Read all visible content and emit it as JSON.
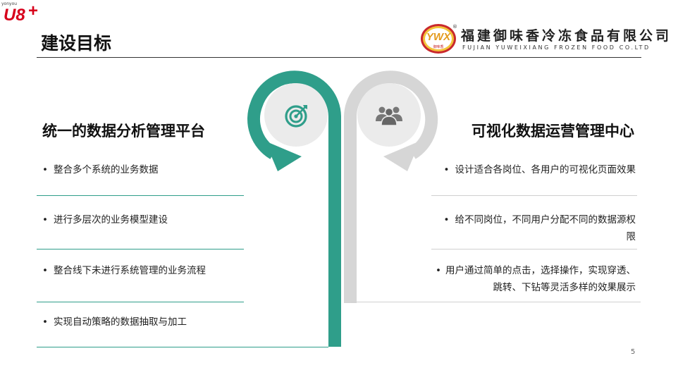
{
  "brand": {
    "tiny": "yonyou",
    "logo": "U8",
    "plus": "+"
  },
  "title": "建设目标",
  "company": {
    "name_zh": "福建御味香冷冻食品有限公司",
    "name_en": "FUJIAN  YUWEIXIANG  FROZEN  FOOD  CO.LTD",
    "reg_mark": "®",
    "logo_letters": "YWX",
    "logo_text": "御味香"
  },
  "left": {
    "title": "统一的数据分析管理平台",
    "items": [
      "整合多个系统的业务数据",
      "进行多层次的业务模型建设",
      "整合线下未进行系统管理的业务流程",
      "实现自动策略的数据抽取与加工"
    ]
  },
  "right": {
    "title": "可视化数据运营管理中心",
    "items": [
      {
        "line1": "设计适合各岗位、各用户的可视化页面效果",
        "line2": ""
      },
      {
        "line1": "给不同岗位，不同用户分配不同的数据源权",
        "line2": "限"
      },
      {
        "line1": "用户通过简单的点击，选择操作，实现穿透、",
        "line2": "跳转、下钻等灵活多样的效果展示"
      }
    ]
  },
  "bullet": "•",
  "icons": {
    "left": "target-icon",
    "right": "people-group-icon"
  },
  "colors": {
    "teal": "#2f9e8a",
    "gray": "#d6d6d6",
    "brand_red": "#d7001b"
  },
  "page_number": "5"
}
